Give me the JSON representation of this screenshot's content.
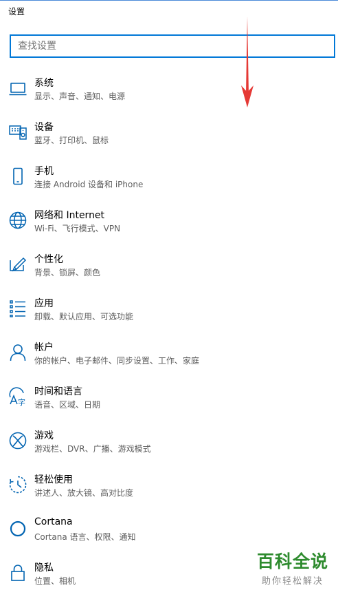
{
  "app": {
    "title": "设置"
  },
  "search": {
    "placeholder": "查找设置"
  },
  "categories": [
    {
      "title": "系统",
      "subtitle": "显示、声音、通知、电源",
      "icon": "laptop-icon"
    },
    {
      "title": "设备",
      "subtitle": "蓝牙、打印机、鼠标",
      "icon": "devices-icon"
    },
    {
      "title": "手机",
      "subtitle": "连接 Android 设备和 iPhone",
      "icon": "phone-icon"
    },
    {
      "title": "网络和 Internet",
      "subtitle": "Wi-Fi、飞行模式、VPN",
      "icon": "globe-icon"
    },
    {
      "title": "个性化",
      "subtitle": "背景、锁屏、颜色",
      "icon": "paint-icon"
    },
    {
      "title": "应用",
      "subtitle": "卸载、默认应用、可选功能",
      "icon": "apps-list-icon"
    },
    {
      "title": "帐户",
      "subtitle": "你的帐户、电子邮件、同步设置、工作、家庭",
      "icon": "person-icon"
    },
    {
      "title": "时间和语言",
      "subtitle": "语音、区域、日期",
      "icon": "time-language-icon"
    },
    {
      "title": "游戏",
      "subtitle": "游戏栏、DVR、广播、游戏模式",
      "icon": "xbox-icon"
    },
    {
      "title": "轻松使用",
      "subtitle": "讲述人、放大镜、高对比度",
      "icon": "ease-of-access-icon"
    },
    {
      "title": "Cortana",
      "subtitle": "Cortana 语言、权限、通知",
      "icon": "cortana-icon"
    },
    {
      "title": "隐私",
      "subtitle": "位置、相机",
      "icon": "lock-icon"
    }
  ],
  "watermark": {
    "title": "百科全说",
    "subtitle": "助你轻松解决"
  },
  "colors": {
    "accent": "#0078d7",
    "annotation": "#e53935",
    "watermark": "#2e8b2e"
  }
}
